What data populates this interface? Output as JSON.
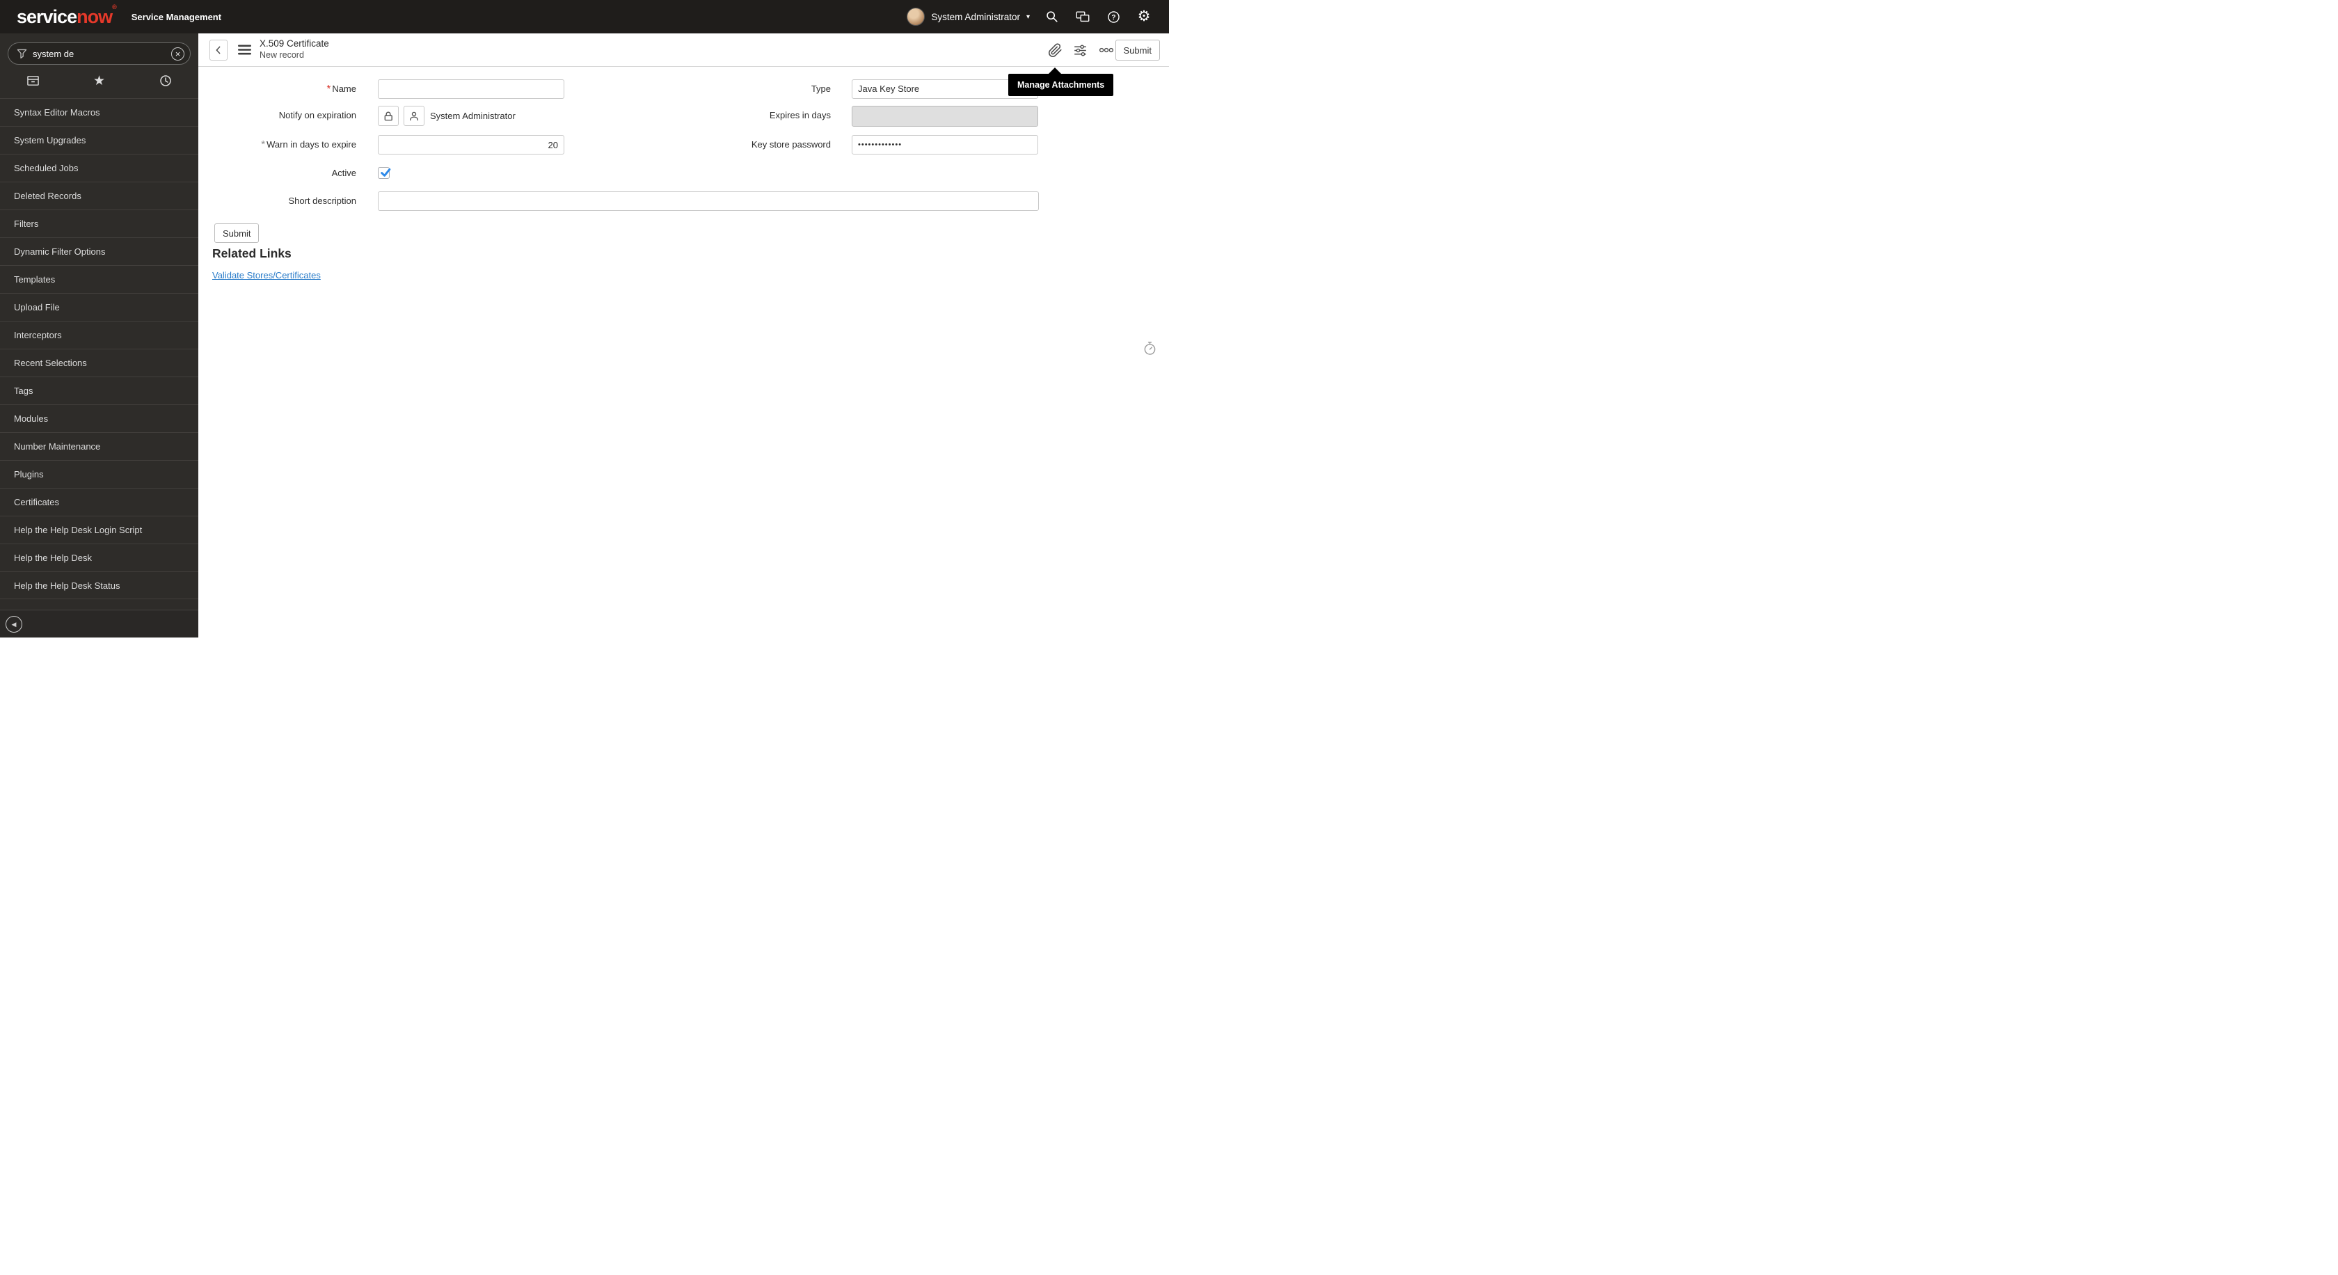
{
  "header": {
    "logo_service": "service",
    "logo_now": "now",
    "logo_reg": "®",
    "product": "Service Management",
    "user": "System Administrator"
  },
  "sidebar": {
    "search_value": "system de",
    "items": [
      "Syntax Editor Macros",
      "System Upgrades",
      "Scheduled Jobs",
      "Deleted Records",
      "Filters",
      "Dynamic Filter Options",
      "Templates",
      "Upload File",
      "Interceptors",
      "Recent Selections",
      "Tags",
      "Modules",
      "Number Maintenance",
      "Plugins",
      "Certificates",
      "Help the Help Desk Login Script",
      "Help the Help Desk",
      "Help the Help Desk Status"
    ]
  },
  "content_header": {
    "title": "X.509 Certificate",
    "subtitle": "New record",
    "submit_label": "Submit",
    "tooltip": "Manage Attachments"
  },
  "form": {
    "required_marker": "*",
    "name_label": "Name",
    "notify_label": "Notify on expiration",
    "notify_value": "System Administrator",
    "warn_label": "Warn in days to expire",
    "warn_value": "20",
    "active_label": "Active",
    "short_description_label": "Short description",
    "type_label": "Type",
    "type_value": "Java Key Store",
    "expires_label": "Expires in days",
    "password_label": "Key store password",
    "password_value": "•••••••••••••",
    "submit_label": "Submit"
  },
  "related_links": {
    "title": "Related Links",
    "links": [
      "Validate Stores/Certificates"
    ]
  },
  "icons": {
    "star": "★",
    "gear": "⚙",
    "caret_down": "▾",
    "collapse": "◀",
    "clear": "×"
  }
}
